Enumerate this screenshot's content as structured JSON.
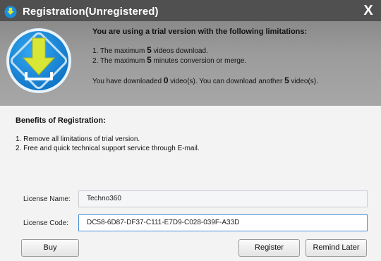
{
  "titlebar": {
    "title": "Registration(Unregistered)",
    "close_glyph": "X"
  },
  "header": {
    "heading": "You are using a trial version with the following limitations:",
    "limits": [
      {
        "prefix": "1. The maximum ",
        "value": "5",
        "suffix": " videos download."
      },
      {
        "prefix": "2. The maximum ",
        "value": "5",
        "suffix": " minutes conversion or merge."
      }
    ],
    "download_status": {
      "part1": "You have downloaded ",
      "downloaded": "0",
      "part2": " video(s). You can download another ",
      "remaining": "5",
      "part3": " video(s)."
    }
  },
  "benefits": {
    "heading": "Benefits of Registration:",
    "items": [
      "1. Remove all limitations of trial version.",
      "2. Free and quick technical support service through E-mail."
    ]
  },
  "form": {
    "license_name_label": "License Name:",
    "license_name_value": "Techno360",
    "license_code_label": "License Code:",
    "license_code_value": "DC58-6D87-DF37-C111-E7D9-C028-039F-A33D"
  },
  "buttons": {
    "buy": "Buy",
    "register": "Register",
    "remind_later": "Remind Later"
  },
  "colors": {
    "titlebar_bg": "#505050",
    "logo_blue": "#1a8fe0",
    "logo_arrow": "#d8e636",
    "input_focus_border": "#4a90d9"
  },
  "icons": {
    "app_icon": "download-arrow-icon",
    "logo": "download-logo-icon",
    "close": "close-icon"
  }
}
